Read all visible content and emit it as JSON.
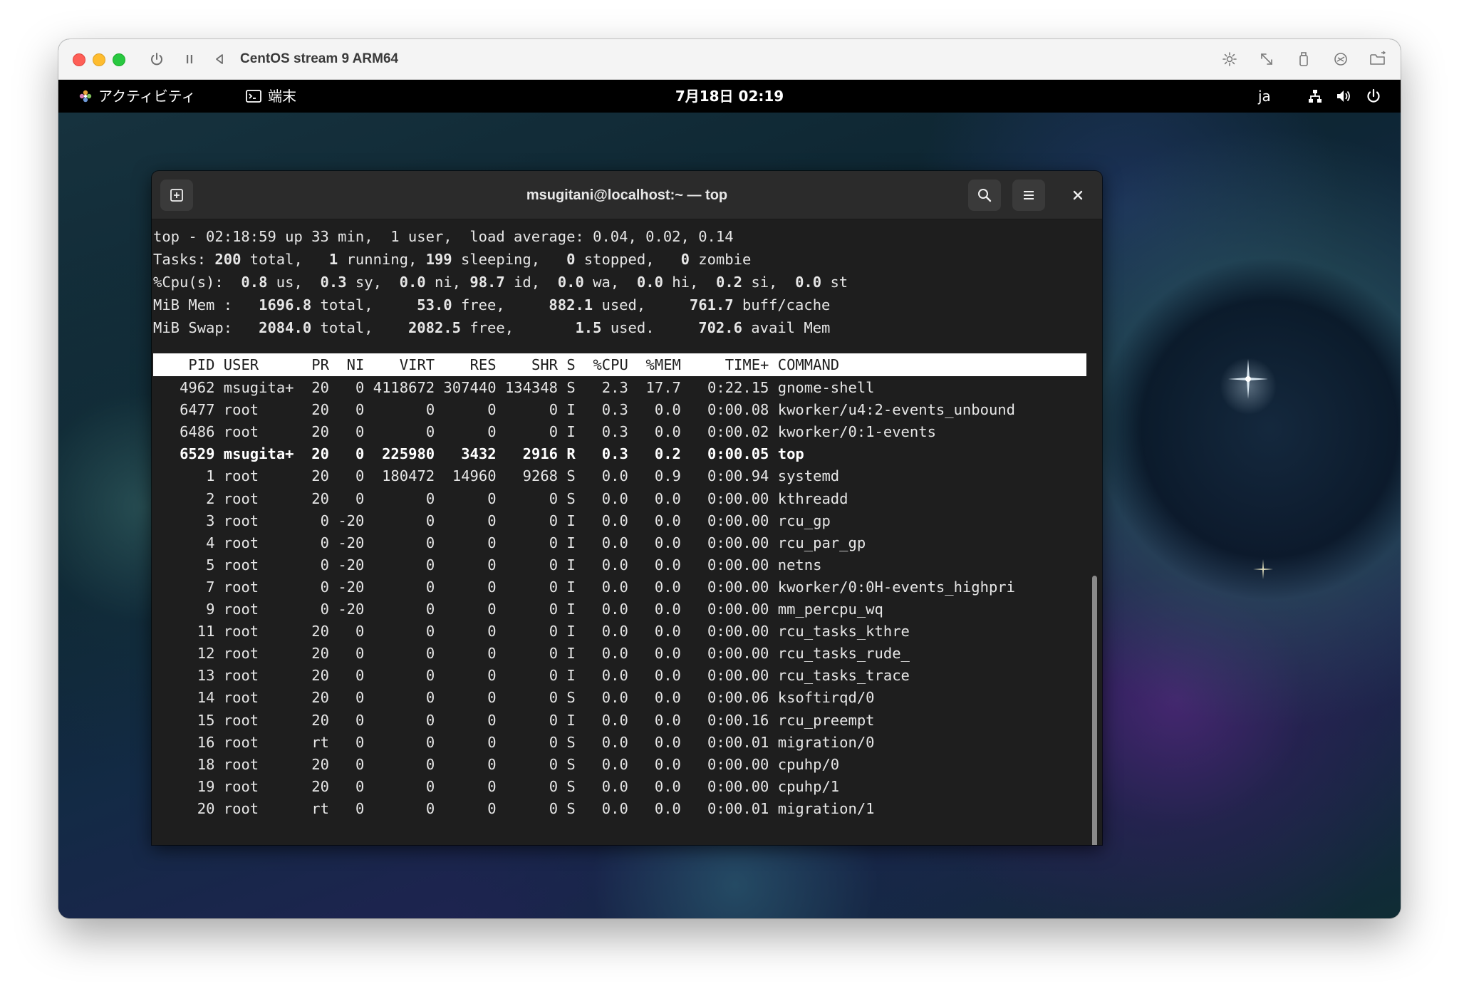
{
  "vm_window": {
    "title": "CentOS stream 9 ARM64"
  },
  "gnome_topbar": {
    "activities": "アクティビティ",
    "app_name": "端末",
    "clock": "7月18日 02:19",
    "input_method": "ja"
  },
  "terminal": {
    "title": "msugitani@localhost:~ — top",
    "summary": {
      "line1": {
        "prefix": "top - 02:18:59 up 33 min,  1 user,  load average: 0.04, 0.02, 0.14"
      },
      "tasks": {
        "label": "Tasks: ",
        "total": "200",
        "total_label": " total,   ",
        "running": "1",
        "running_label": " running, ",
        "sleeping": "199",
        "sleeping_label": " sleeping,   ",
        "stopped": "0",
        "stopped_label": " stopped,   ",
        "zombie": "0",
        "zombie_label": " zombie"
      },
      "cpu": {
        "label": "%Cpu(s):  ",
        "us": "0.8",
        "us_label": " us,  ",
        "sy": "0.3",
        "sy_label": " sy,  ",
        "ni": "0.0",
        "ni_label": " ni, ",
        "id": "98.7",
        "id_label": " id,  ",
        "wa": "0.0",
        "wa_label": " wa,  ",
        "hi": "0.0",
        "hi_label": " hi,  ",
        "si": "0.2",
        "si_label": " si,  ",
        "st": "0.0",
        "st_label": " st"
      },
      "mem": {
        "label": "MiB Mem :   ",
        "total": "1696.8",
        "total_label": " total,     ",
        "free": "53.0",
        "free_label": " free,     ",
        "used": "882.1",
        "used_label": " used,     ",
        "buff": "761.7",
        "buff_label": " buff/cache"
      },
      "swap": {
        "label": "MiB Swap:   ",
        "total": "2084.0",
        "total_label": " total,    ",
        "free": "2082.5",
        "free_label": " free,       ",
        "used": "1.5",
        "used_label": " used.     ",
        "avail": "702.6",
        "avail_label": " avail Mem"
      }
    },
    "columns": [
      "PID",
      "USER",
      "PR",
      "NI",
      "VIRT",
      "RES",
      "SHR",
      "S",
      "%CPU",
      "%MEM",
      "TIME+",
      "COMMAND"
    ],
    "processes": [
      {
        "pid": "4962",
        "user": "msugita+",
        "pr": "20",
        "ni": "0",
        "virt": "4118672",
        "res": "307440",
        "shr": "134348",
        "s": "S",
        "cpu": "2.3",
        "mem": "17.7",
        "time": "0:22.15",
        "cmd": "gnome-shell",
        "bold": false
      },
      {
        "pid": "6477",
        "user": "root",
        "pr": "20",
        "ni": "0",
        "virt": "0",
        "res": "0",
        "shr": "0",
        "s": "I",
        "cpu": "0.3",
        "mem": "0.0",
        "time": "0:00.08",
        "cmd": "kworker/u4:2-events_unbound",
        "bold": false
      },
      {
        "pid": "6486",
        "user": "root",
        "pr": "20",
        "ni": "0",
        "virt": "0",
        "res": "0",
        "shr": "0",
        "s": "I",
        "cpu": "0.3",
        "mem": "0.0",
        "time": "0:00.02",
        "cmd": "kworker/0:1-events",
        "bold": false
      },
      {
        "pid": "6529",
        "user": "msugita+",
        "pr": "20",
        "ni": "0",
        "virt": "225980",
        "res": "3432",
        "shr": "2916",
        "s": "R",
        "cpu": "0.3",
        "mem": "0.2",
        "time": "0:00.05",
        "cmd": "top",
        "bold": true
      },
      {
        "pid": "1",
        "user": "root",
        "pr": "20",
        "ni": "0",
        "virt": "180472",
        "res": "14960",
        "shr": "9268",
        "s": "S",
        "cpu": "0.0",
        "mem": "0.9",
        "time": "0:00.94",
        "cmd": "systemd",
        "bold": false
      },
      {
        "pid": "2",
        "user": "root",
        "pr": "20",
        "ni": "0",
        "virt": "0",
        "res": "0",
        "shr": "0",
        "s": "S",
        "cpu": "0.0",
        "mem": "0.0",
        "time": "0:00.00",
        "cmd": "kthreadd",
        "bold": false
      },
      {
        "pid": "3",
        "user": "root",
        "pr": "0",
        "ni": "-20",
        "virt": "0",
        "res": "0",
        "shr": "0",
        "s": "I",
        "cpu": "0.0",
        "mem": "0.0",
        "time": "0:00.00",
        "cmd": "rcu_gp",
        "bold": false
      },
      {
        "pid": "4",
        "user": "root",
        "pr": "0",
        "ni": "-20",
        "virt": "0",
        "res": "0",
        "shr": "0",
        "s": "I",
        "cpu": "0.0",
        "mem": "0.0",
        "time": "0:00.00",
        "cmd": "rcu_par_gp",
        "bold": false
      },
      {
        "pid": "5",
        "user": "root",
        "pr": "0",
        "ni": "-20",
        "virt": "0",
        "res": "0",
        "shr": "0",
        "s": "I",
        "cpu": "0.0",
        "mem": "0.0",
        "time": "0:00.00",
        "cmd": "netns",
        "bold": false
      },
      {
        "pid": "7",
        "user": "root",
        "pr": "0",
        "ni": "-20",
        "virt": "0",
        "res": "0",
        "shr": "0",
        "s": "I",
        "cpu": "0.0",
        "mem": "0.0",
        "time": "0:00.00",
        "cmd": "kworker/0:0H-events_highpri",
        "bold": false
      },
      {
        "pid": "9",
        "user": "root",
        "pr": "0",
        "ni": "-20",
        "virt": "0",
        "res": "0",
        "shr": "0",
        "s": "I",
        "cpu": "0.0",
        "mem": "0.0",
        "time": "0:00.00",
        "cmd": "mm_percpu_wq",
        "bold": false
      },
      {
        "pid": "11",
        "user": "root",
        "pr": "20",
        "ni": "0",
        "virt": "0",
        "res": "0",
        "shr": "0",
        "s": "I",
        "cpu": "0.0",
        "mem": "0.0",
        "time": "0:00.00",
        "cmd": "rcu_tasks_kthre",
        "bold": false
      },
      {
        "pid": "12",
        "user": "root",
        "pr": "20",
        "ni": "0",
        "virt": "0",
        "res": "0",
        "shr": "0",
        "s": "I",
        "cpu": "0.0",
        "mem": "0.0",
        "time": "0:00.00",
        "cmd": "rcu_tasks_rude_",
        "bold": false
      },
      {
        "pid": "13",
        "user": "root",
        "pr": "20",
        "ni": "0",
        "virt": "0",
        "res": "0",
        "shr": "0",
        "s": "I",
        "cpu": "0.0",
        "mem": "0.0",
        "time": "0:00.00",
        "cmd": "rcu_tasks_trace",
        "bold": false
      },
      {
        "pid": "14",
        "user": "root",
        "pr": "20",
        "ni": "0",
        "virt": "0",
        "res": "0",
        "shr": "0",
        "s": "S",
        "cpu": "0.0",
        "mem": "0.0",
        "time": "0:00.06",
        "cmd": "ksoftirqd/0",
        "bold": false
      },
      {
        "pid": "15",
        "user": "root",
        "pr": "20",
        "ni": "0",
        "virt": "0",
        "res": "0",
        "shr": "0",
        "s": "I",
        "cpu": "0.0",
        "mem": "0.0",
        "time": "0:00.16",
        "cmd": "rcu_preempt",
        "bold": false
      },
      {
        "pid": "16",
        "user": "root",
        "pr": "rt",
        "ni": "0",
        "virt": "0",
        "res": "0",
        "shr": "0",
        "s": "S",
        "cpu": "0.0",
        "mem": "0.0",
        "time": "0:00.01",
        "cmd": "migration/0",
        "bold": false
      },
      {
        "pid": "18",
        "user": "root",
        "pr": "20",
        "ni": "0",
        "virt": "0",
        "res": "0",
        "shr": "0",
        "s": "S",
        "cpu": "0.0",
        "mem": "0.0",
        "time": "0:00.00",
        "cmd": "cpuhp/0",
        "bold": false
      },
      {
        "pid": "19",
        "user": "root",
        "pr": "20",
        "ni": "0",
        "virt": "0",
        "res": "0",
        "shr": "0",
        "s": "S",
        "cpu": "0.0",
        "mem": "0.0",
        "time": "0:00.00",
        "cmd": "cpuhp/1",
        "bold": false
      },
      {
        "pid": "20",
        "user": "root",
        "pr": "rt",
        "ni": "0",
        "virt": "0",
        "res": "0",
        "shr": "0",
        "s": "S",
        "cpu": "0.0",
        "mem": "0.0",
        "time": "0:00.01",
        "cmd": "migration/1",
        "bold": false
      }
    ]
  },
  "icons": {
    "vm_power": "power-icon",
    "vm_pause": "pause-icon",
    "vm_back": "back-icon",
    "vm_brightness": "brightness-icon",
    "vm_resize": "resize-icon",
    "vm_usb": "usb-icon",
    "vm_share": "share-icon",
    "vm_folder": "folder-icon",
    "new_tab": "new-tab-icon",
    "search": "search-icon",
    "menu": "hamburger-menu-icon",
    "close": "close-icon",
    "network": "network-icon",
    "volume": "volume-icon",
    "system_power": "power-icon"
  },
  "colors": {
    "terminal_bg": "#1e1e1e",
    "header_row_bg": "#ffffff",
    "topbar_bg": "#000000",
    "traffic_red": "#fe5f57",
    "traffic_yellow": "#febc2e",
    "traffic_green": "#28c840"
  }
}
